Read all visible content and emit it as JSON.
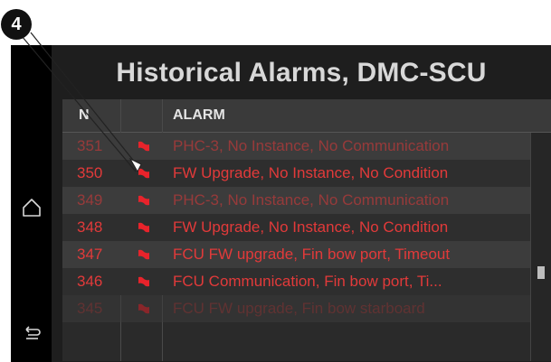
{
  "callout": {
    "number": "4"
  },
  "navigation": {
    "home_icon": "home-outline-icon",
    "back_icon": "back-arrow-icon"
  },
  "screen": {
    "title": "Historical Alarms, DMC-SCU",
    "table": {
      "headers": {
        "nr": "N",
        "alarm": "ALARM"
      },
      "rows": [
        {
          "nr": "351",
          "alarm": "PHC-3, No Instance, No Communication",
          "dim": true
        },
        {
          "nr": "350",
          "alarm": "FW Upgrade, No Instance, No Condition",
          "dim": false
        },
        {
          "nr": "349",
          "alarm": "PHC-3, No Instance, No Communication",
          "dim": true
        },
        {
          "nr": "348",
          "alarm": "FW Upgrade, No Instance, No Condition",
          "dim": false
        },
        {
          "nr": "347",
          "alarm": "FCU FW upgrade, Fin bow port, Timeout",
          "dim": false
        },
        {
          "nr": "346",
          "alarm": "FCU Communication, Fin bow port, Ti...",
          "dim": false
        },
        {
          "nr": "345",
          "alarm": "FCU FW upgrade, Fin bow starboard",
          "dim": true
        }
      ],
      "scroll_position": 0.62
    }
  },
  "colors": {
    "alarm_text": "#e23a3a",
    "flag": "#e8232b",
    "title": "#d8d8d8"
  }
}
